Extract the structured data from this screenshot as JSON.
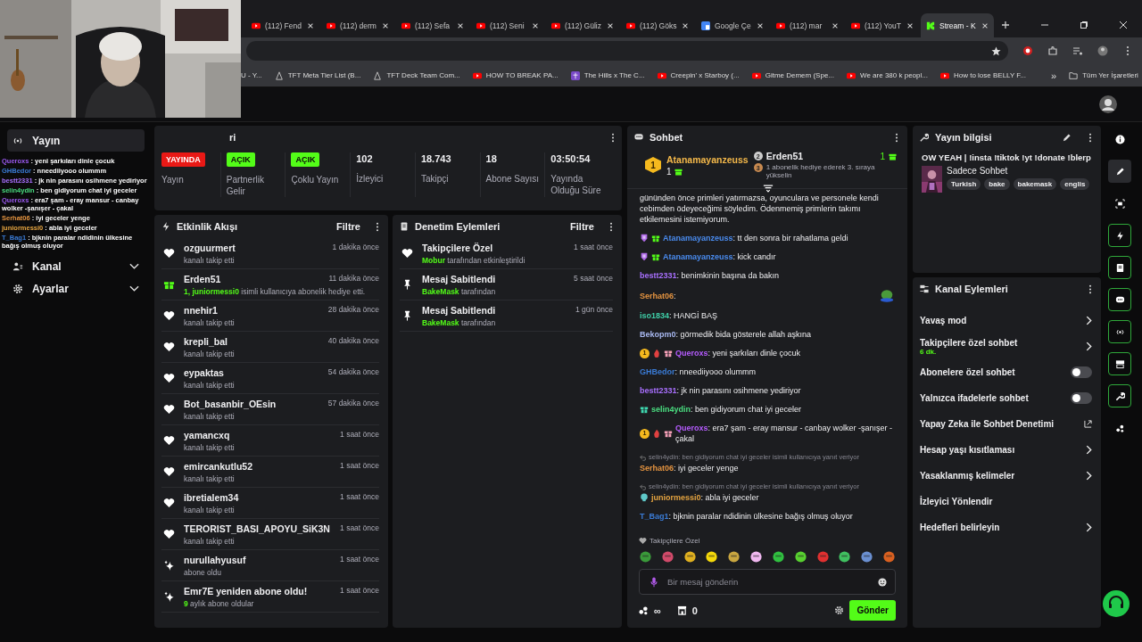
{
  "browser": {
    "tabs": [
      {
        "title": "(112) Fend",
        "kind": "youtube",
        "selected": false
      },
      {
        "title": "(112) derm",
        "kind": "youtube",
        "selected": false
      },
      {
        "title": "(112) Sefa",
        "kind": "youtube",
        "selected": false
      },
      {
        "title": "(112) Seni",
        "kind": "youtube",
        "selected": false
      },
      {
        "title": "(112) Güliz",
        "kind": "youtube",
        "selected": false
      },
      {
        "title": "(112) Göks",
        "kind": "youtube",
        "selected": false
      },
      {
        "title": "Google Çe",
        "kind": "google",
        "selected": false
      },
      {
        "title": "(112) mar",
        "kind": "youtube",
        "selected": false
      },
      {
        "title": "(112) YouT",
        "kind": "youtube",
        "selected": false
      },
      {
        "title": "Stream - K",
        "kind": "kick",
        "selected": true
      }
    ],
    "bookmarks": [
      {
        "title": "U - Y...",
        "kind": "plain"
      },
      {
        "title": "TFT Meta Tier List (B...",
        "kind": "site"
      },
      {
        "title": "TFT Deck Team Com...",
        "kind": "site"
      },
      {
        "title": "HOW TO BREAK PA...",
        "kind": "youtube"
      },
      {
        "title": "The Hills x The C...",
        "kind": "music"
      },
      {
        "title": "Creepin' x Starboy (...",
        "kind": "youtube"
      },
      {
        "title": "Gitme Demem (Spe...",
        "kind": "youtube"
      },
      {
        "title": "We are 380 k peopl...",
        "kind": "youtube"
      },
      {
        "title": "How to lose BELLY F...",
        "kind": "youtube"
      }
    ],
    "more": "»",
    "all_bookmarks": "Tüm Yer İşaretleri"
  },
  "sidebar": {
    "items": [
      {
        "label": "Yayın",
        "kind": "broadcast",
        "selected": true
      },
      {
        "label": "Kanal",
        "kind": "users",
        "selected": false
      },
      {
        "label": "Ayarlar",
        "kind": "gear",
        "selected": false
      }
    ]
  },
  "overlay_chat": [
    {
      "name": "Queroxs",
      "color": "#9b59f0",
      "text": ": yeni şarkıları dinle çocuk"
    },
    {
      "name": "GHBedor",
      "color": "#3a7bd5",
      "text": ": nneediiyooo olummm"
    },
    {
      "name": "bestt2331",
      "color": "#a970ff",
      "text": ": jk nin parasını osihmene yediriyor"
    },
    {
      "name": "selin4ydin",
      "color": "#4ade80",
      "text": ": ben gidiyorum chat iyi geceler"
    },
    {
      "name": "Queroxs",
      "color": "#9b59f0",
      "text": ": era7 şam - eray mansur - canbay wolker -şanışer - çakal"
    },
    {
      "name": "Serhat06",
      "color": "#e59440",
      "text": ": iyi geceler yenge"
    },
    {
      "name": "juniormessi0",
      "color": "#e5a440",
      "text": ": abla iyi geceler"
    },
    {
      "name": "T_Bag1",
      "color": "#3a7bd5",
      "text": ": bjknin paralar ndidinin ülkesine bağış olmuş oluyor"
    }
  ],
  "stream_panel": {
    "title": "ri",
    "stats": [
      {
        "kind": "badge",
        "value": "YAYINDA",
        "color": "#e91916",
        "label": "Yayın"
      },
      {
        "kind": "badge",
        "value": "AÇIK",
        "color": "#53fc18",
        "label": "Partnerlik Gelir"
      },
      {
        "kind": "badge",
        "value": "AÇIK",
        "color": "#53fc18",
        "label": "Çoklu Yayın"
      },
      {
        "kind": "number",
        "value": "102",
        "label": "İzleyici"
      },
      {
        "kind": "number",
        "value": "18.743",
        "label": "Takipçi"
      },
      {
        "kind": "number",
        "value": "18",
        "label": "Abone Sayısı"
      },
      {
        "kind": "number",
        "value": "03:50:54",
        "label": "Yayında Olduğu Süre"
      }
    ]
  },
  "activity": {
    "title": "Etkinlik Akışı",
    "filter": "Filtre",
    "items": [
      {
        "kind": "follow",
        "name": "ozguurmert",
        "text": "kanalı takip etti",
        "time": "1 dakika önce"
      },
      {
        "kind": "gift",
        "name": "Erden51",
        "highlight": "1, juniormessi0",
        "text": " isimli kullanıcıya abonelik hediye etti.",
        "time": "11 dakika önce"
      },
      {
        "kind": "follow",
        "name": "nnehir1",
        "text": "kanalı takip etti",
        "time": "28 dakika önce"
      },
      {
        "kind": "follow",
        "name": "krepli_bal",
        "text": "kanalı takip etti",
        "time": "40 dakika önce"
      },
      {
        "kind": "follow",
        "name": "eypaktas",
        "text": "kanalı takip etti",
        "time": "54 dakika önce"
      },
      {
        "kind": "follow",
        "name": "Bot_basanbir_OEsin",
        "text": "kanalı takip etti",
        "time": "57 dakika önce"
      },
      {
        "kind": "follow",
        "name": "yamancxq",
        "text": "kanalı takip etti",
        "time": "1 saat önce"
      },
      {
        "kind": "follow",
        "name": "emircankutlu52",
        "text": "kanalı takip etti",
        "time": "1 saat önce"
      },
      {
        "kind": "follow",
        "name": "ibretialem34",
        "text": "kanalı takip etti",
        "time": "1 saat önce"
      },
      {
        "kind": "follow",
        "name": "TERORIST_BASI_APOYU_SiK3N",
        "text": "kanalı takip etti",
        "time": "1 saat önce"
      },
      {
        "kind": "sub",
        "name": "nurullahyusuf",
        "text": "abone oldu",
        "time": "1 saat önce"
      },
      {
        "kind": "sub",
        "name": "Emr7E yeniden abone oldu!",
        "highlight": "9",
        "text": " aylık abone oldular",
        "time": "1 saat önce"
      }
    ]
  },
  "moderation": {
    "title": "Denetim Eylemleri",
    "filter": "Filtre",
    "items": [
      {
        "kind": "heart",
        "title": "Takipçilere Özel",
        "user": "Mobur",
        "text": " tarafından etkinleştirildi",
        "time": "1 saat önce"
      },
      {
        "kind": "pin",
        "title": "Mesaj Sabitlendi",
        "user": "BakeMask",
        "text": " tarafından",
        "time": "5 saat önce"
      },
      {
        "kind": "pin",
        "title": "Mesaj Sabitlendi",
        "user": "BakeMask",
        "text": " tarafından",
        "time": "1 gün önce"
      }
    ]
  },
  "chat": {
    "title": "Sohbet",
    "leaders": [
      {
        "rank": "1",
        "name": "Atanamayanzeuss",
        "count": "1"
      },
      {
        "rank": "2",
        "name": "Erden51",
        "count": "1"
      }
    ],
    "next_rank": {
      "rank": "3",
      "text": "1 abonelik hediye ederek 3. sıraya yükselin"
    },
    "messages": [
      {
        "kind": "text",
        "text": "gününden önce primleri yatırmazsa, oyunculara ve personele kendi cebimden ödeyeceğimi söyledim. Ödenmemiş primlerin takımı etkilemesini istemiyorum."
      },
      {
        "kind": "message",
        "badges": [
          {
            "kind": "mod"
          },
          {
            "kind": "sub"
          }
        ],
        "name": "Atanamayanzeuss",
        "color": "#4a8cf0",
        "text": ": tt den sonra bir rahatlama geldi"
      },
      {
        "kind": "message",
        "badges": [
          {
            "kind": "mod"
          },
          {
            "kind": "sub"
          }
        ],
        "name": "Atanamayanzeuss",
        "color": "#4a8cf0",
        "text": ": kick candır"
      },
      {
        "kind": "message",
        "name": "bestt2331",
        "color": "#a970ff",
        "text": ": benimkinin başına da bakın"
      },
      {
        "kind": "emote",
        "name": "Serhat06",
        "color": "#e59440",
        "text": ":"
      },
      {
        "kind": "message",
        "name": "iso1834",
        "color": "#3fcfa8",
        "text": ": HANGİ BAŞ"
      },
      {
        "kind": "message",
        "name": "Bekopm0",
        "color": "#a8b8f0",
        "text": ": görmedik bida gösterele allah aşkına"
      },
      {
        "kind": "message",
        "badges": [
          {
            "kind": "rank",
            "text": "1"
          },
          {
            "kind": "vip"
          },
          {
            "kind": "gift"
          }
        ],
        "name": "Queroxs",
        "color": "#b65cff",
        "text": ": yeni şarkıları dinle çocuk"
      },
      {
        "kind": "message",
        "name": "GHBedor",
        "color": "#3a7bd5",
        "text": ": nneediiyooo olummm"
      },
      {
        "kind": "message",
        "name": "bestt2331",
        "color": "#a970ff",
        "text": ": jk nin parasını osihmene yediriyor"
      },
      {
        "kind": "message",
        "badges": [
          {
            "kind": "sub-teal"
          }
        ],
        "name": "selin4ydin",
        "color": "#4ade80",
        "text": ": ben gidiyorum chat iyi geceler"
      },
      {
        "kind": "message",
        "badges": [
          {
            "kind": "rank",
            "text": "1"
          },
          {
            "kind": "vip"
          },
          {
            "kind": "gift"
          }
        ],
        "name": "Queroxs",
        "color": "#b65cff",
        "text": ": era7 şam - eray mansur - canbay wolker -şanışer - çakal"
      },
      {
        "kind": "message",
        "reply": "selin4ydin: ben gidiyorum chat iyi geceler isimli kullanıcıya yanıt veriyor",
        "name": "Serhat06",
        "color": "#e59440",
        "text": ": iyi geceler yenge"
      },
      {
        "kind": "message",
        "reply": "selin4ydin: ben gidiyorum chat iyi geceler isimli kullanıcıya yanıt veriyor",
        "badges": [
          {
            "kind": "founder"
          }
        ],
        "name": "juniormessi0",
        "color": "#e5a440",
        "text": ": abla iyi geceler"
      },
      {
        "kind": "message",
        "name": "T_Bag1",
        "color": "#3a7bd5",
        "text": ": bjknin paralar ndidinin ülkesine bağış olmuş oluyor"
      }
    ],
    "emote_set": "Takipçilere Özel",
    "input": {
      "placeholder": "Bir mesaj gönderin"
    },
    "points": "∞",
    "count": "0",
    "send": "Gönder"
  },
  "stream_info": {
    "title": "Yayın bilgisi",
    "stream_title": "OW YEAH | !insta !tiktok !yt !donate !blerp",
    "category": "Sadece Sohbet",
    "tags": [
      "Turkish",
      "bake",
      "bakemask",
      "englis"
    ]
  },
  "channel_actions": {
    "title": "Kanal Eylemleri",
    "items": [
      {
        "kind": "arrow",
        "label": "Yavaş mod"
      },
      {
        "kind": "arrow",
        "label": "Takipçilere özel sohbet",
        "sub": "6 dk."
      },
      {
        "kind": "toggle",
        "label": "Abonelere özel sohbet",
        "on": false
      },
      {
        "kind": "toggle",
        "label": "Yalnızca ifadelerle sohbet",
        "on": false
      },
      {
        "kind": "external",
        "label": "Yapay Zeka ile Sohbet Denetimi"
      },
      {
        "kind": "arrow",
        "label": "Hesap yaşı kısıtlaması"
      },
      {
        "kind": "arrow",
        "label": "Yasaklanmış kelimeler"
      },
      {
        "kind": "plain",
        "label": "İzleyici Yönlendir"
      },
      {
        "kind": "arrow",
        "label": "Hedefleri belirleyin"
      }
    ]
  },
  "rail": [
    {
      "kind": "info",
      "selected": false,
      "pinned": false
    },
    {
      "kind": "pencil",
      "selected": true,
      "pinned": false
    },
    {
      "kind": "capture",
      "selected": false,
      "pinned": false
    },
    {
      "kind": "bolt",
      "selected": false,
      "pinned": true
    },
    {
      "kind": "note",
      "selected": false,
      "pinned": true
    },
    {
      "kind": "chat",
      "selected": false,
      "pinned": true
    },
    {
      "kind": "broadcast",
      "selected": false,
      "pinned": true
    },
    {
      "kind": "camera",
      "selected": false,
      "pinned": true
    },
    {
      "kind": "wrench",
      "selected": false,
      "pinned": true
    },
    {
      "kind": "dots",
      "selected": false,
      "pinned": false
    }
  ]
}
